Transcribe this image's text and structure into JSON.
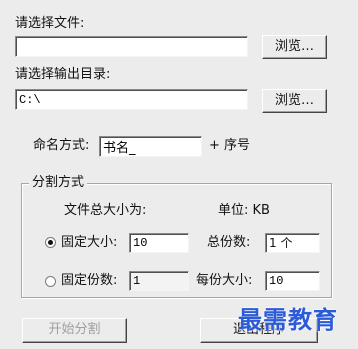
{
  "file": {
    "label": "请选择文件:",
    "value": "",
    "browse_label": "浏览…"
  },
  "output": {
    "label": "请选择输出目录:",
    "value": "C:\\",
    "browse_label": "浏览…"
  },
  "naming": {
    "label": "命名方式:",
    "value": "书名_",
    "suffix": "+ 序号"
  },
  "split": {
    "group_title": "分割方式",
    "total_size_label": "文件总大小为:",
    "unit_label": "单位: KB",
    "fixed_size": {
      "label": "固定大小:",
      "selected": true,
      "value": "10",
      "total_parts_label": "总份数:",
      "total_parts_value": "1 个"
    },
    "fixed_count": {
      "label": "固定份数:",
      "selected": false,
      "value": "1",
      "part_size_label": "每份大小:",
      "part_size_value": "10"
    }
  },
  "buttons": {
    "start_label": "开始分割",
    "exit_label": "退出程序"
  },
  "watermark": "最需教育"
}
